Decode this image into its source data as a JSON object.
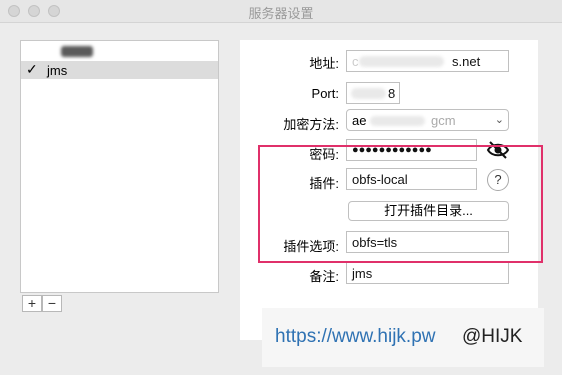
{
  "window": {
    "title": "服务器设置"
  },
  "server_list": {
    "items": [
      {
        "label": "",
        "checked": false
      },
      {
        "label": "jms",
        "checked": true,
        "check_glyph": "✓"
      }
    ],
    "add_label": "+",
    "remove_label": "−"
  },
  "form": {
    "address": {
      "label": "地址:",
      "value": "c... s.net",
      "visible_suffix": "s.net"
    },
    "port": {
      "label": "Port:",
      "value": "...8",
      "visible_suffix": "8"
    },
    "encryption": {
      "label": "加密方法:",
      "value": "aes-...-gcm",
      "visible_prefix": "ae",
      "visible_suffix": "gcm"
    },
    "password": {
      "label": "密码:",
      "value": "●●●●●●●●●●●●"
    },
    "plugin": {
      "label": "插件:",
      "value": "obfs-local"
    },
    "help_label": "?",
    "open_plugin_dir_label": "打开插件目录...",
    "plugin_options": {
      "label": "插件选项:",
      "value": "obfs=tls"
    },
    "remark": {
      "label": "备注:",
      "value": "jms"
    }
  },
  "icons": {
    "eye": "eye-icon",
    "chevron": "chevron-updown-icon"
  },
  "colors": {
    "highlight": "#e0306a",
    "url": "#2f72b3"
  },
  "watermark": {
    "url": "https://www.hijk.pw",
    "handle": "@HIJK"
  }
}
